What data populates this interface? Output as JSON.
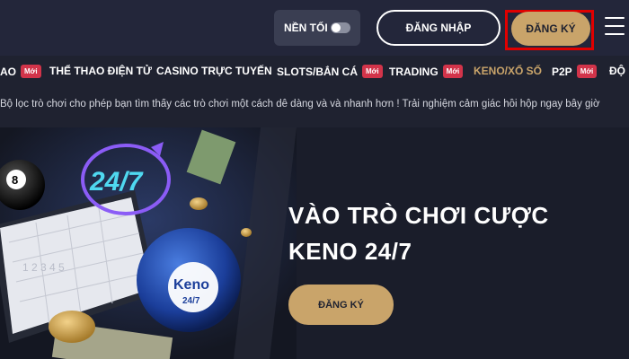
{
  "header": {
    "dark_mode_label": "NỀN TỐI",
    "login_label": "ĐĂNG NHẬP",
    "signup_label": "ĐĂNG KÝ"
  },
  "nav": {
    "items": [
      {
        "label": "AO",
        "badge": "Mới"
      },
      {
        "label": "THỂ THAO ĐIỆN TỬ",
        "badge": ""
      },
      {
        "label": "CASINO TRỰC TUYẾN",
        "badge": ""
      },
      {
        "label": "SLOTS/BẮN CÁ",
        "badge": "Mới"
      },
      {
        "label": "TRADING",
        "badge": "Mới"
      },
      {
        "label": "KENO/XỔ SỐ",
        "badge": ""
      },
      {
        "label": "P2P",
        "badge": "Mới"
      },
      {
        "label": "ĐỘ",
        "badge": ""
      }
    ]
  },
  "marquee": "Bộ lọc trò chơi cho phép bạn tìm thấy các trò chơi một cách dễ dàng và và nhanh hơn ! Trải nghiệm cảm giác hồi hộp ngay bây giờ",
  "hero": {
    "title_line1": "VÀO TRÒ CHƠI CƯỢC",
    "title_line2": "KENO 24/7",
    "cta_label": "ĐĂNG KÝ",
    "art": {
      "label_24_7": "24/7",
      "ball_number": "8",
      "keno_logo": "Keno",
      "keno_sub": "24/7"
    }
  },
  "colors": {
    "background": "#1f2230",
    "accent_gold": "#c9a46a",
    "badge_red": "#d2344a",
    "highlight_red": "#e00000"
  }
}
